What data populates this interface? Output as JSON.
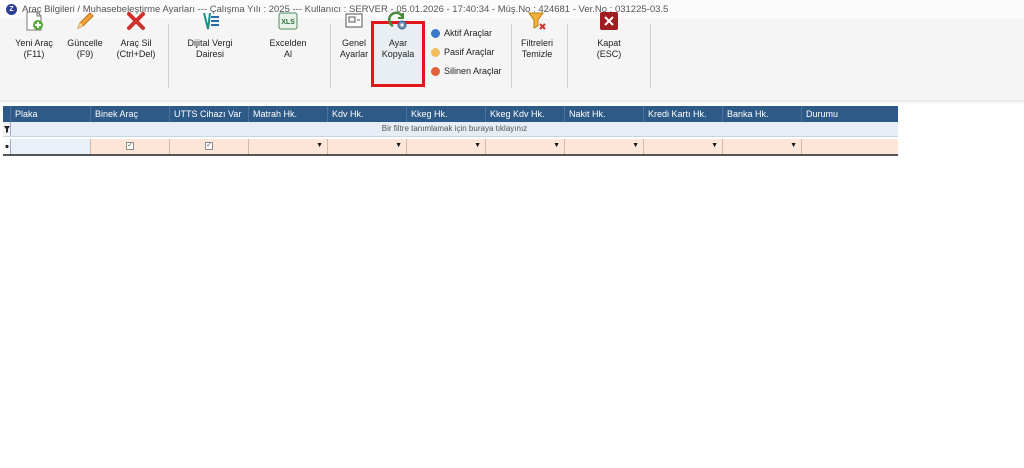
{
  "window": {
    "title": "Araç Bilgileri / Muhasebeleştirme Ayarları  ---  Çalışma Yılı : 2025  ---  Kullanıcı : SERVER - 05.01.2026 - 17:40:34 - Müş.No : 424681 - Ver.No : 031225-03.5"
  },
  "toolbar": {
    "yeni_arac": "Yeni Araç\n(F11)",
    "guncelle": "Güncelle\n(F9)",
    "arac_sil": "Araç Sil\n(Ctrl+Del)",
    "dijital_vergi": "Dijital Vergi\nDairesi",
    "excelden_al": "Excelden\nAl",
    "genel_ayarlar": "Genel\nAyarlar",
    "ayar_kopyala": "Ayar\nKopyala",
    "filtreleri_temizle": "Filtreleri\nTemizle",
    "kapat": "Kapat\n(ESC)"
  },
  "legend": {
    "aktif": "Aktif Araçlar",
    "pasif": "Pasif Araçlar",
    "silinen": "Silinen Araçlar"
  },
  "colors": {
    "aktif": "#3a78c9",
    "pasif": "#f0c060",
    "silinen": "#e0623a",
    "header": "#2e5a87",
    "highlight": "#e3161b"
  },
  "grid": {
    "columns": [
      "Plaka",
      "Binek Araç",
      "UTTS Cihazı Var",
      "Matrah Hk.",
      "Kdv Hk.",
      "Kkeg Hk.",
      "Kkeg Kdv Hk.",
      "Nakit Hk.",
      "Kredi Kartı Hk.",
      "Banka Hk.",
      "Durumu"
    ],
    "filter_hint": "Bir filtre tanımlamak için buraya tıklayınız"
  }
}
